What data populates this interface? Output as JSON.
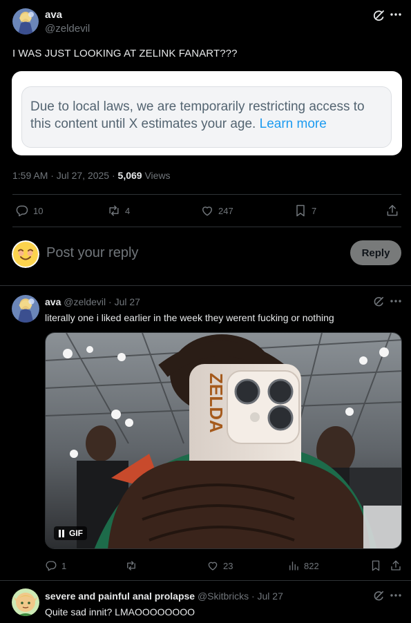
{
  "main_post": {
    "display_name": "ava",
    "handle": "@zeldevil",
    "text": "I WAS JUST LOOKING AT ZELINK FANART???",
    "restricted_notice": "Due to local laws, we are temporarily restricting access to this content until X estimates your age.",
    "learn_more": "Learn more",
    "time": "1:59 AM · Jul 27, 2025 · ",
    "views_count": "5,069",
    "views_label": " Views",
    "replies": "10",
    "reposts": "4",
    "likes": "247",
    "bookmarks": "7"
  },
  "composer": {
    "placeholder": "Post your reply",
    "reply_button": "Reply"
  },
  "reply1": {
    "display_name": "ava",
    "handle": "@zeldevil",
    "date": " · Jul 27",
    "text": "literally one i liked earlier in the week they werent fucking or nothing",
    "gif_label": "GIF",
    "replies": "1",
    "likes": "23",
    "views": "822"
  },
  "reply2": {
    "display_name": "severe and painful anal prolapse",
    "handle": "@Skitbricks",
    "date": " · Jul 27",
    "text": "Quite sad innit? LMAOOOOOOOO"
  },
  "icons": {
    "grok": "grok-icon",
    "more": "more-icon",
    "reply": "reply-icon",
    "repost": "repost-icon",
    "like": "heart-icon",
    "bookmark": "bookmark-icon",
    "share": "share-icon",
    "views": "views-icon",
    "pause": "pause-icon"
  },
  "colors": {
    "background": "#000000",
    "text": "#e7e9ea",
    "muted": "#71767b",
    "link": "#1d9bf0",
    "divider": "#2f3336"
  }
}
